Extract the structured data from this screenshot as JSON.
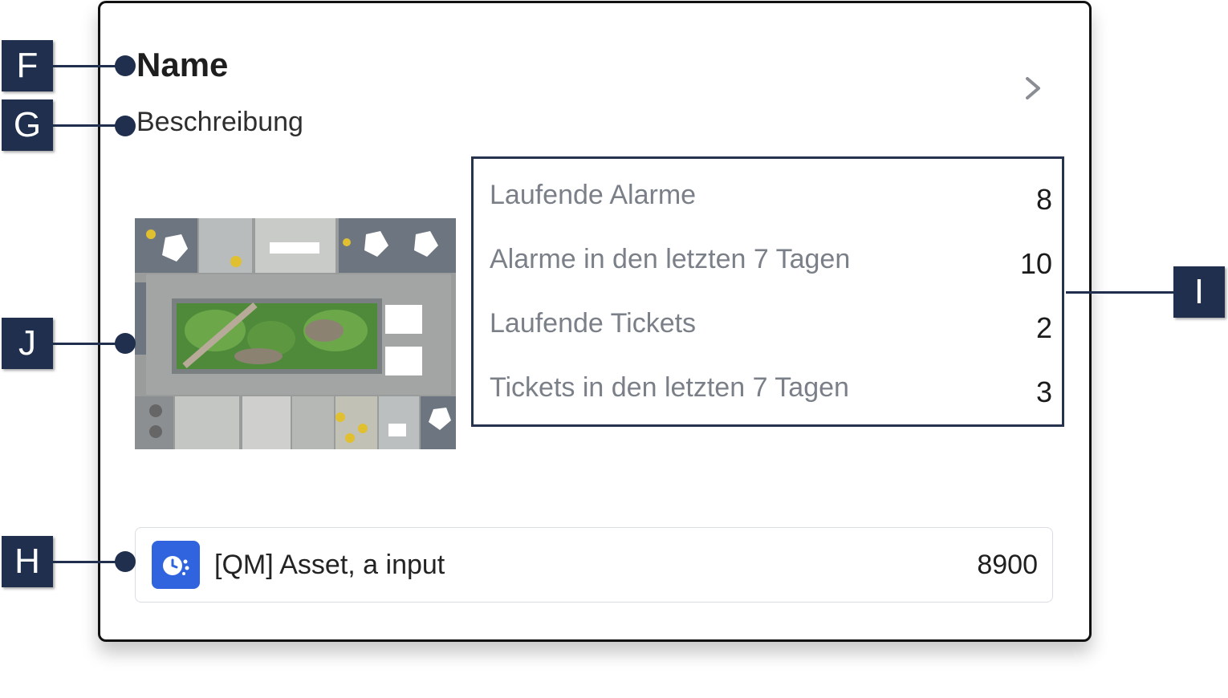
{
  "card": {
    "name": "Name",
    "description": "Beschreibung"
  },
  "stats": [
    {
      "label": "Laufende Alarme",
      "value": "8"
    },
    {
      "label": "Alarme in den letzten 7 Tagen",
      "value": "10"
    },
    {
      "label": "Laufende Tickets",
      "value": "2"
    },
    {
      "label": "Tickets in den letzten 7 Tagen",
      "value": "3"
    }
  ],
  "asset": {
    "label": "[QM] Asset, a input",
    "value": "8900",
    "icon": "clock-asset-icon"
  },
  "callouts": {
    "f": "F",
    "g": "G",
    "h": "H",
    "i": "I",
    "j": "J"
  },
  "colors": {
    "callout": "#1f2f4d",
    "asset_icon": "#2f64de"
  }
}
